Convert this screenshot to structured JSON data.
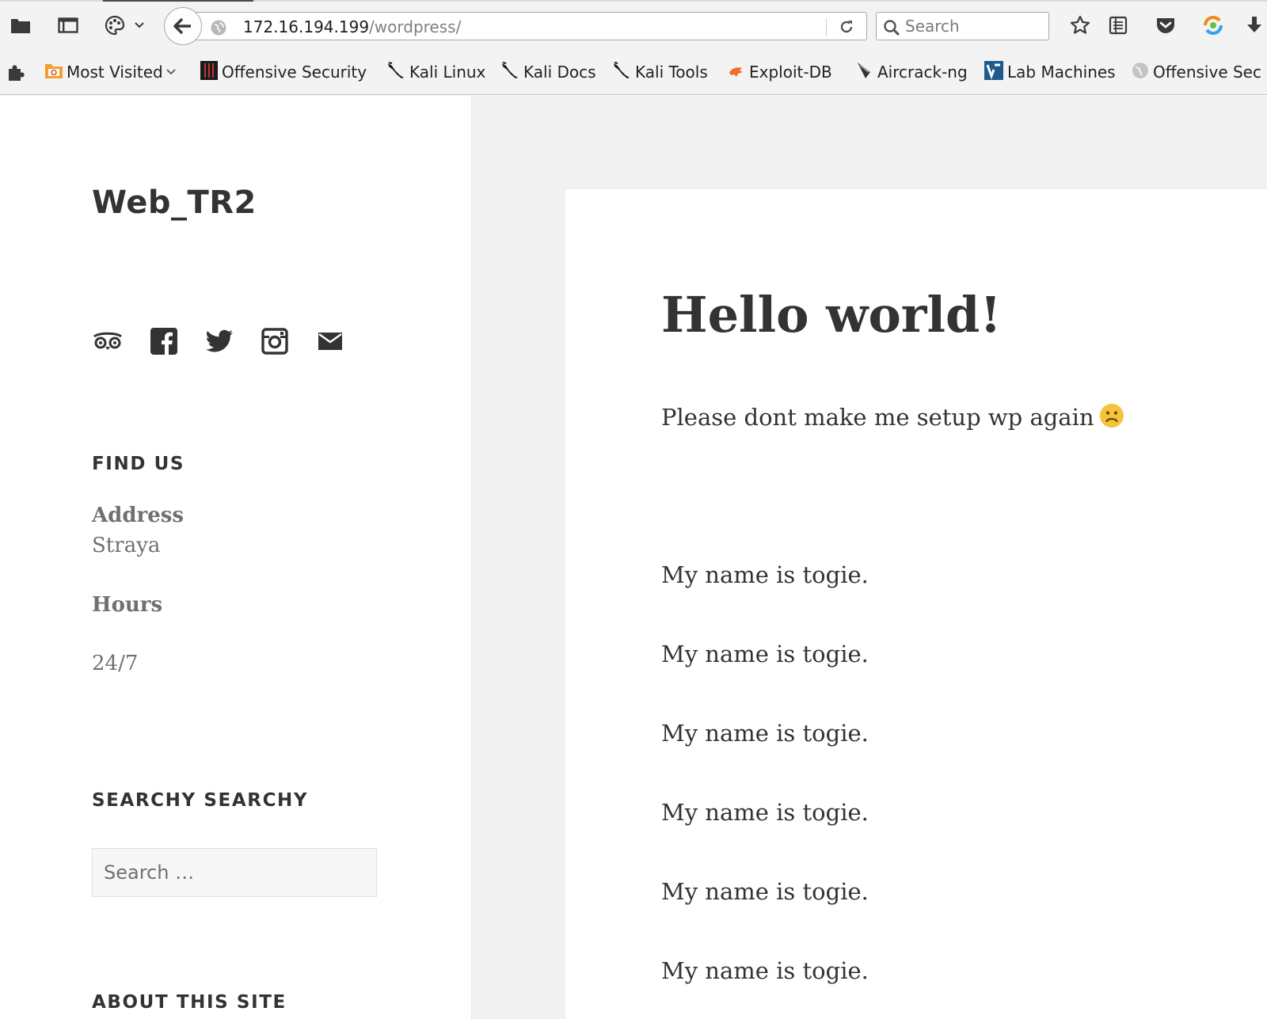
{
  "browser": {
    "url_host": "172.16.194.199",
    "url_path": "/wordpress/",
    "search_placeholder": "Search",
    "bookmarks": [
      {
        "label": "Most Visited",
        "icon": "folder-icon"
      },
      {
        "label": "Offensive Security",
        "icon": "offsec-icon"
      },
      {
        "label": "Kali Linux",
        "icon": "kali-dragon-icon"
      },
      {
        "label": "Kali Docs",
        "icon": "kali-dragon-icon"
      },
      {
        "label": "Kali Tools",
        "icon": "kali-dragon-icon"
      },
      {
        "label": "Exploit-DB",
        "icon": "exploitdb-icon"
      },
      {
        "label": "Aircrack-ng",
        "icon": "aircrack-icon"
      },
      {
        "label": "Lab Machines",
        "icon": "vulnhub-icon"
      },
      {
        "label": "Offensive Sec",
        "icon": "globe-icon"
      }
    ]
  },
  "sidebar": {
    "site_title": "Web_TR2",
    "social_icons": [
      "tripadvisor-icon",
      "facebook-icon",
      "twitter-icon",
      "instagram-icon",
      "mail-icon"
    ],
    "find_us": {
      "title": "FIND US",
      "address_label": "Address",
      "address_value": "Straya",
      "hours_label": "Hours",
      "hours_value": "24/7"
    },
    "search_widget": {
      "title": "SEARCHY SEARCHY",
      "placeholder": "Search …"
    },
    "about_title": "ABOUT THIS SITE"
  },
  "post": {
    "title": "Hello world!",
    "intro": "Please dont make me setup wp again",
    "paragraphs": [
      "My name is togie.",
      "My name is togie.",
      "My name is togie.",
      "My name is togie.",
      "My name is togie.",
      "My name is togie."
    ]
  },
  "colors": {
    "page_bg": "#f1f1f1",
    "text": "#333333",
    "muted": "#707070",
    "emoji": "#f5c33b"
  }
}
